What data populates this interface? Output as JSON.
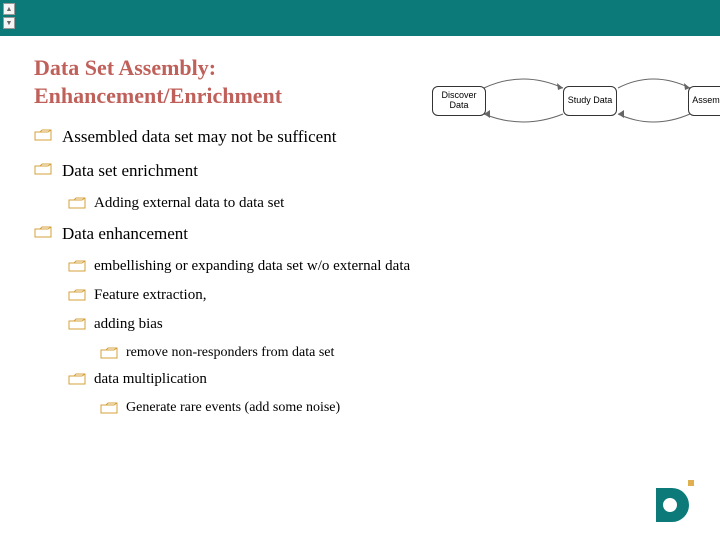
{
  "title_line1": "Data Set Assembly:",
  "title_line2": "Enhancement/Enrichment",
  "bullets": {
    "b1_1": "Assembled data set may not be sufficent",
    "b1_2": "Data set enrichment",
    "b2_1": "Adding external data to data set",
    "b1_3": "Data enhancement",
    "b2_2": "embellishing  or expanding data set w/o external data",
    "b2_3": "Feature extraction,",
    "b2_4": "adding bias",
    "b3_1": "remove non-responders from data set",
    "b2_5": " data multiplication",
    "b3_2": "Generate rare events (add some noise)"
  },
  "diagram": {
    "box1": "Discover Data",
    "box2": "Study Data",
    "box3": "Assemble"
  },
  "colors": {
    "brand_teal": "#0d7a7a",
    "title_red": "#c0605a",
    "folder_gold": "#d4a038"
  }
}
